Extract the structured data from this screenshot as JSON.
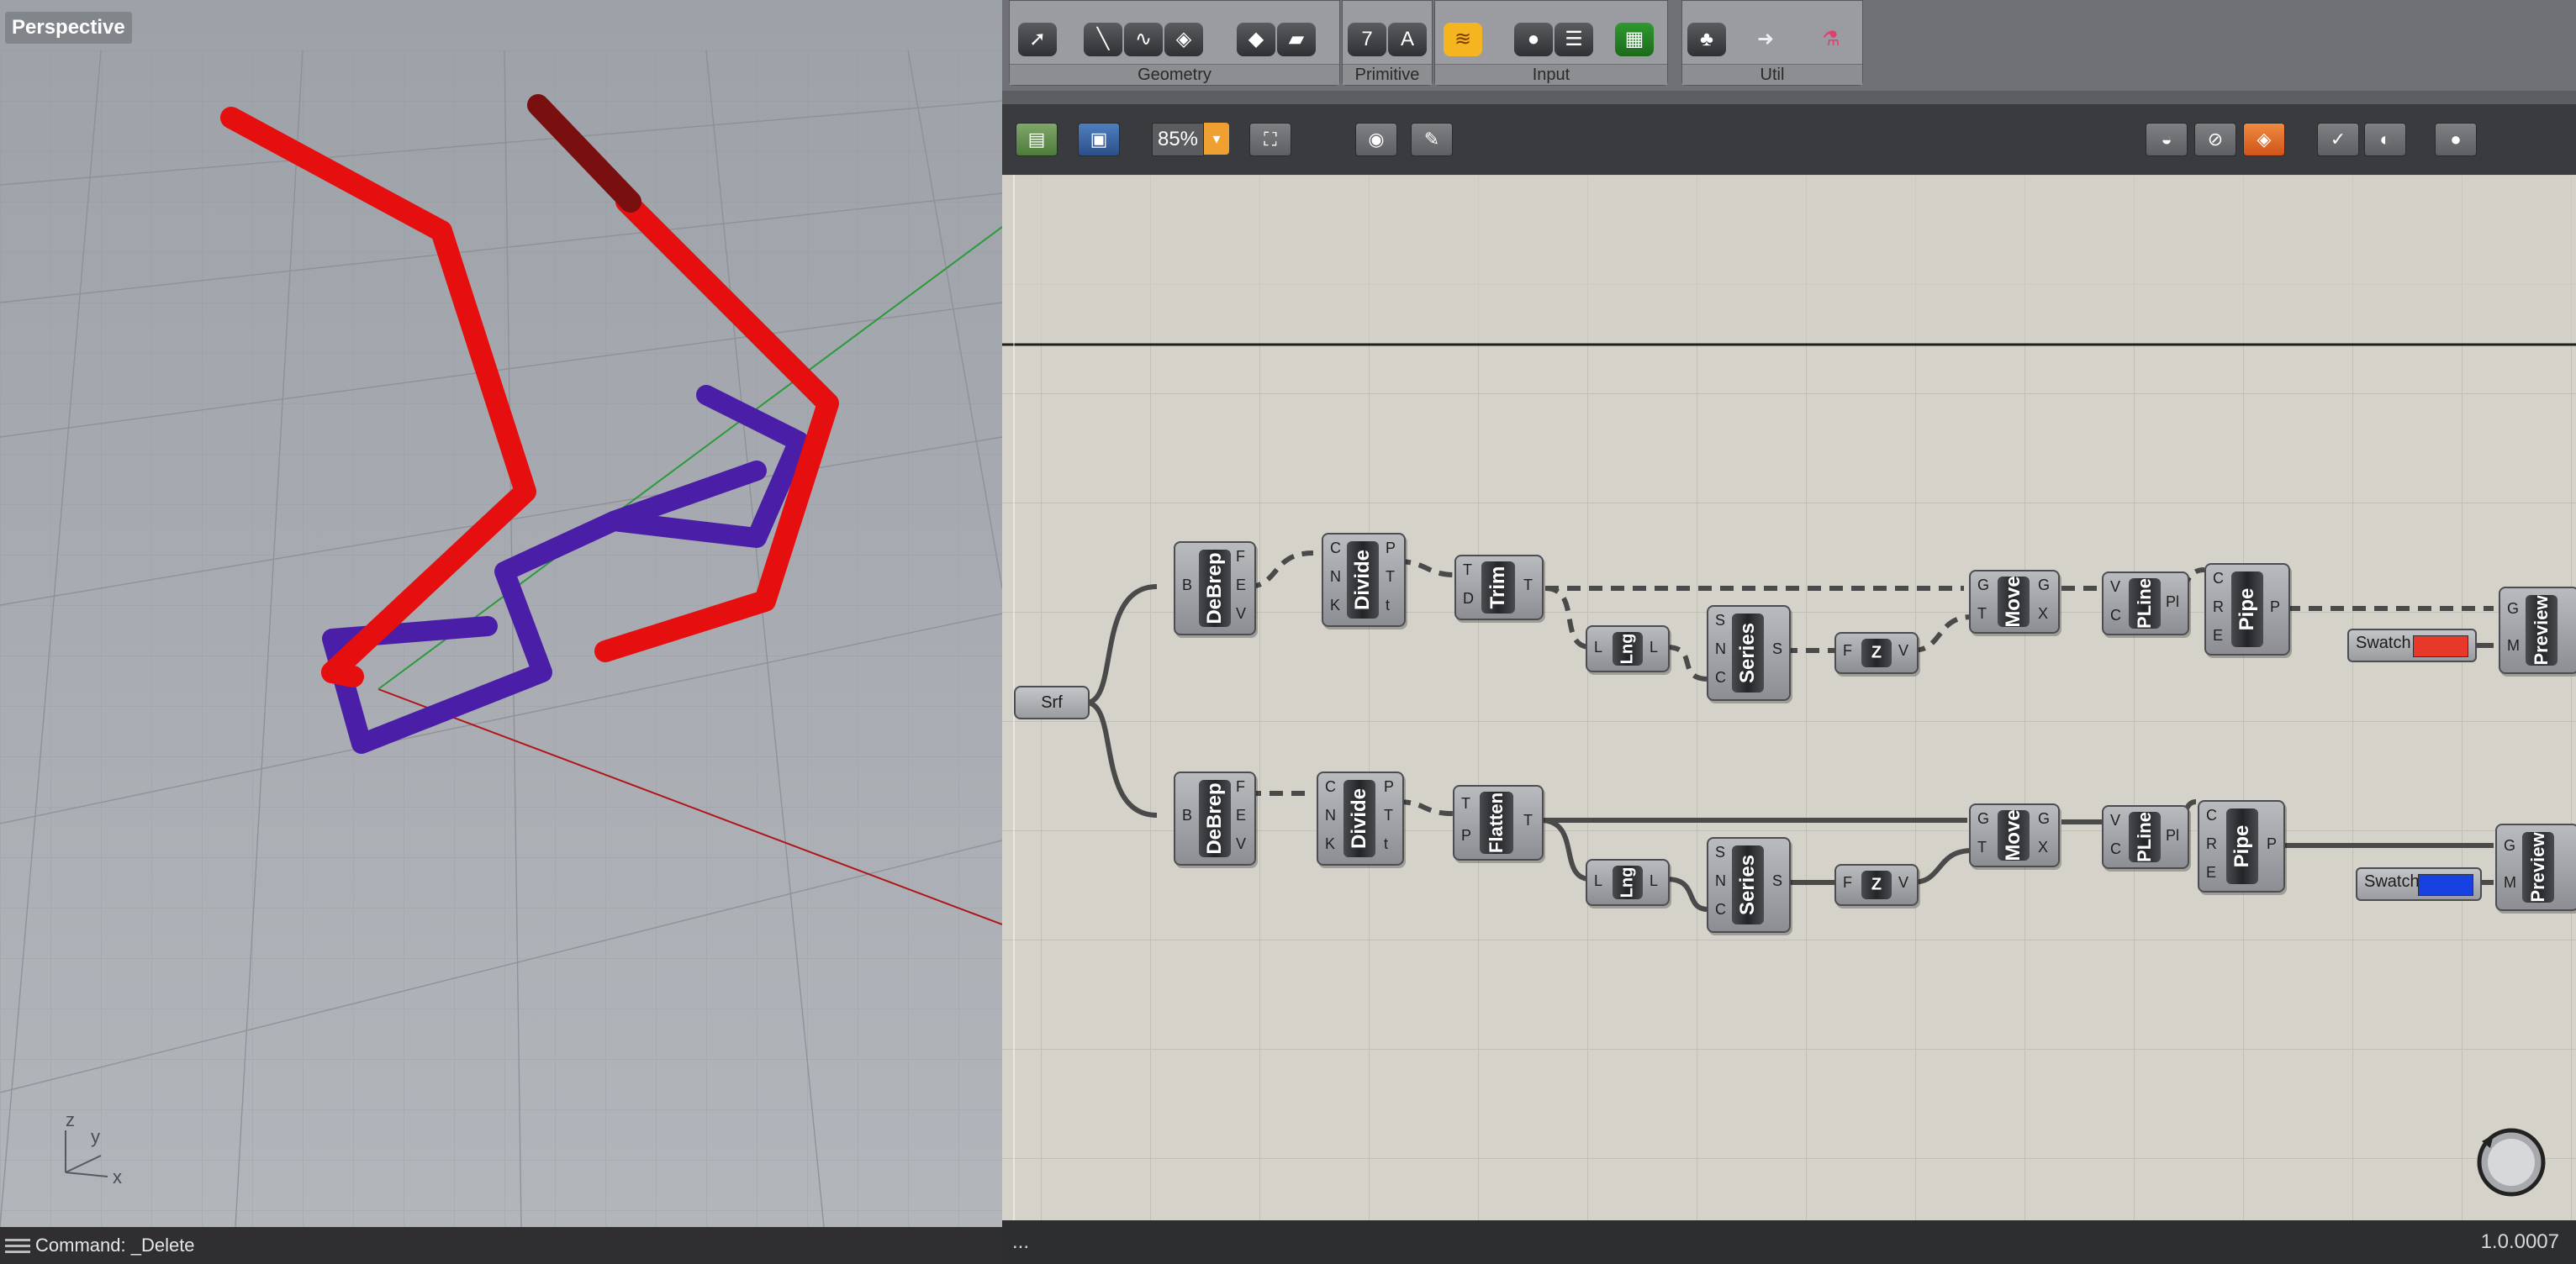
{
  "viewport": {
    "title": "Perspective",
    "axis_labels": {
      "z": "z",
      "y": "y",
      "x": "x"
    },
    "colors": {
      "red_curves": "#e50f0f",
      "blue_curves": "#4b1ea8",
      "background": "#a3a8ae"
    }
  },
  "command": {
    "text": "Command: _Delete"
  },
  "ribbon": {
    "panels": [
      {
        "label": "Geometry"
      },
      {
        "label": "Primitive"
      },
      {
        "label": "Input"
      },
      {
        "label": "Util"
      }
    ],
    "primitive_glyphs": {
      "seven": "7",
      "letter": "A"
    }
  },
  "toolbar": {
    "zoom": "85%",
    "icons": [
      "open-icon",
      "save-icon",
      "zoom-extents-icon",
      "preview-eye-icon",
      "sketch-icon",
      "preview-mode-icons"
    ]
  },
  "canvas": {
    "source": {
      "label": "Srf"
    },
    "row1": {
      "debrep": {
        "name": "DeBrep",
        "inputs": [
          "B"
        ],
        "outputs": [
          "F",
          "E",
          "V"
        ]
      },
      "divide": {
        "name": "Divide",
        "inputs": [
          "C",
          "N",
          "K"
        ],
        "outputs": [
          "P",
          "T",
          "t"
        ]
      },
      "trim": {
        "name": "Trim",
        "inputs": [
          "T",
          "D"
        ],
        "outputs": [
          "T"
        ]
      },
      "lng": {
        "name": "Lng",
        "inputs": [
          "L"
        ],
        "outputs": [
          "L"
        ]
      },
      "series": {
        "name": "Series",
        "inputs": [
          "S",
          "N",
          "C"
        ],
        "outputs": [
          "S"
        ]
      },
      "z": {
        "name": "Z",
        "inputs": [
          "F"
        ],
        "outputs": [
          "V"
        ]
      },
      "move": {
        "name": "Move",
        "inputs": [
          "G",
          "T"
        ],
        "outputs": [
          "G",
          "X"
        ]
      },
      "pline": {
        "name": "PLine",
        "inputs": [
          "V",
          "C"
        ],
        "outputs": [
          "Pl"
        ]
      },
      "pipe": {
        "name": "Pipe",
        "inputs": [
          "C",
          "R",
          "E"
        ],
        "outputs": [
          "P"
        ]
      },
      "swatch": {
        "name": "Swatch",
        "color": "#e8382a"
      },
      "preview": {
        "name": "Preview",
        "inputs": [
          "G",
          "M"
        ]
      }
    },
    "row2": {
      "debrep": {
        "name": "DeBrep",
        "inputs": [
          "B"
        ],
        "outputs": [
          "F",
          "E",
          "V"
        ]
      },
      "divide": {
        "name": "Divide",
        "inputs": [
          "C",
          "N",
          "K"
        ],
        "outputs": [
          "P",
          "T",
          "t"
        ]
      },
      "flatten": {
        "name": "Flatten",
        "inputs": [
          "T",
          "P"
        ],
        "outputs": [
          "T"
        ]
      },
      "lng": {
        "name": "Lng",
        "inputs": [
          "L"
        ],
        "outputs": [
          "L"
        ]
      },
      "series": {
        "name": "Series",
        "inputs": [
          "S",
          "N",
          "C"
        ],
        "outputs": [
          "S"
        ]
      },
      "z": {
        "name": "Z",
        "inputs": [
          "F"
        ],
        "outputs": [
          "V"
        ]
      },
      "move": {
        "name": "Move",
        "inputs": [
          "G",
          "T"
        ],
        "outputs": [
          "G",
          "X"
        ]
      },
      "pline": {
        "name": "PLine",
        "inputs": [
          "V",
          "C"
        ],
        "outputs": [
          "Pl"
        ]
      },
      "pipe": {
        "name": "Pipe",
        "inputs": [
          "C",
          "R",
          "E"
        ],
        "outputs": [
          "P"
        ]
      },
      "swatch": {
        "name": "Swatch",
        "color": "#1740e0"
      },
      "preview": {
        "name": "Preview",
        "inputs": [
          "G",
          "M"
        ]
      }
    }
  },
  "status": {
    "left": "...",
    "version": "1.0.0007"
  }
}
